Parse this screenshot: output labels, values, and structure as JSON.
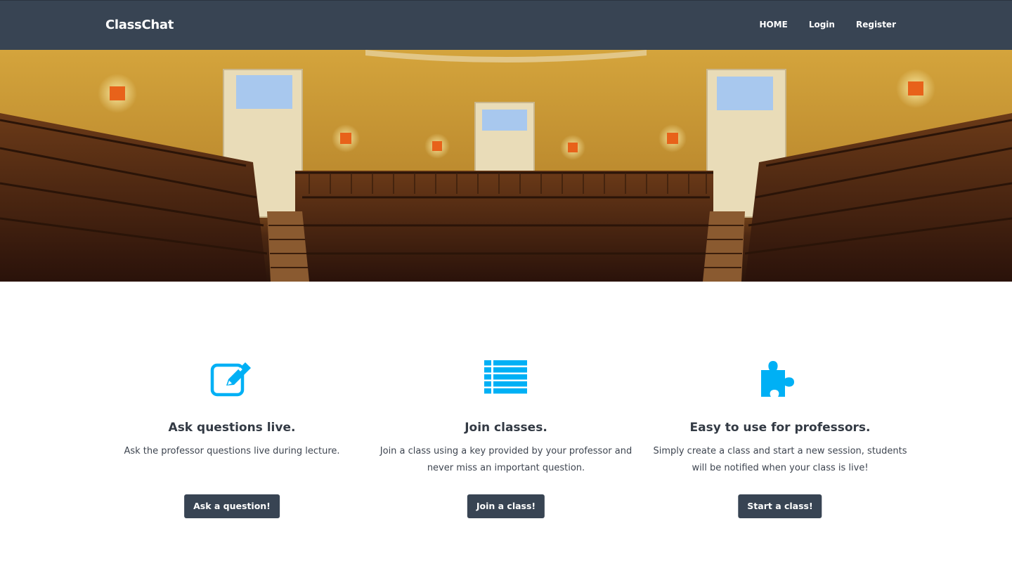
{
  "navbar": {
    "brand": "ClassChat",
    "links": [
      "HOME",
      "Login",
      "Register"
    ]
  },
  "features": [
    {
      "icon": "edit-icon",
      "title": "Ask questions live.",
      "description": "Ask the professor questions live during lecture.",
      "button": "Ask a question!"
    },
    {
      "icon": "list-icon",
      "title": "Join classes.",
      "description": "Join a class using a key provided by your professor and never miss an important question.",
      "button": "Join a class!"
    },
    {
      "icon": "puzzle-piece-icon",
      "title": "Easy to use for professors.",
      "description": "Simply create a class and start a new session, students will be notified when your class is live!",
      "button": "Start a class!"
    }
  ],
  "colors": {
    "navbar": "#384453",
    "accent": "#00b0f5",
    "button": "#384453"
  }
}
